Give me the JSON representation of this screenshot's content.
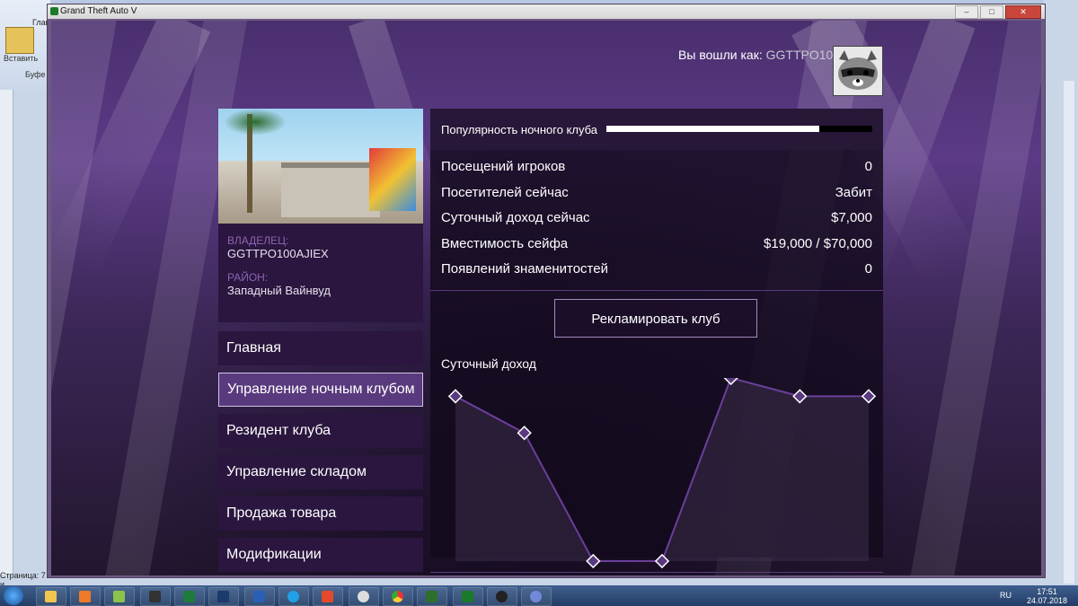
{
  "window": {
    "title": "Grand Theft Auto V"
  },
  "host": {
    "paste_label": "Вставить",
    "clipboard_label": "Буфе",
    "status_label": "Страница: 7 и",
    "tab_label": "Глав"
  },
  "login": {
    "prefix": "Вы вошли как:",
    "username": "GGTTPO100AJIEX"
  },
  "club": {
    "owner_label": "ВЛАДЕЛЕЦ:",
    "owner_value": "GGTTPO100AJIEX",
    "district_label": "РАЙОН:",
    "district_value": "Западный Вайнвуд"
  },
  "menu": [
    {
      "label": "Главная",
      "active": false
    },
    {
      "label": "Управление ночным клубом",
      "active": true
    },
    {
      "label": "Резидент клуба",
      "active": false
    },
    {
      "label": "Управление складом",
      "active": false
    },
    {
      "label": "Продажа товара",
      "active": false
    },
    {
      "label": "Модификации",
      "active": false
    }
  ],
  "popularity": {
    "label": "Популярность ночного клуба",
    "value": 0.8
  },
  "stats": [
    {
      "label": "Посещений игроков",
      "value": "0"
    },
    {
      "label": "Посетителей сейчас",
      "value": "Забит"
    },
    {
      "label": "Суточный доход сейчас",
      "value": "$7,000"
    },
    {
      "label": "Вместимость сейфа",
      "value": "$19,000 / $70,000"
    },
    {
      "label": "Появлений знаменитостей",
      "value": "0"
    }
  ],
  "promote_button": "Рекламировать клуб",
  "chart_data": {
    "type": "line",
    "title": "Суточный доход",
    "xlabel": "",
    "ylabel": "",
    "values": [
      0.9,
      0.7,
      0.0,
      0.0,
      1.0,
      0.9,
      0.9
    ],
    "ylim": [
      0,
      1
    ]
  },
  "taskbar": {
    "lang": "RU",
    "time": "17:51",
    "date": "24.07.2018"
  },
  "colors": {
    "accent": "#5a3a7e",
    "panel": "#2a163e",
    "line": "#6a3f9a"
  }
}
